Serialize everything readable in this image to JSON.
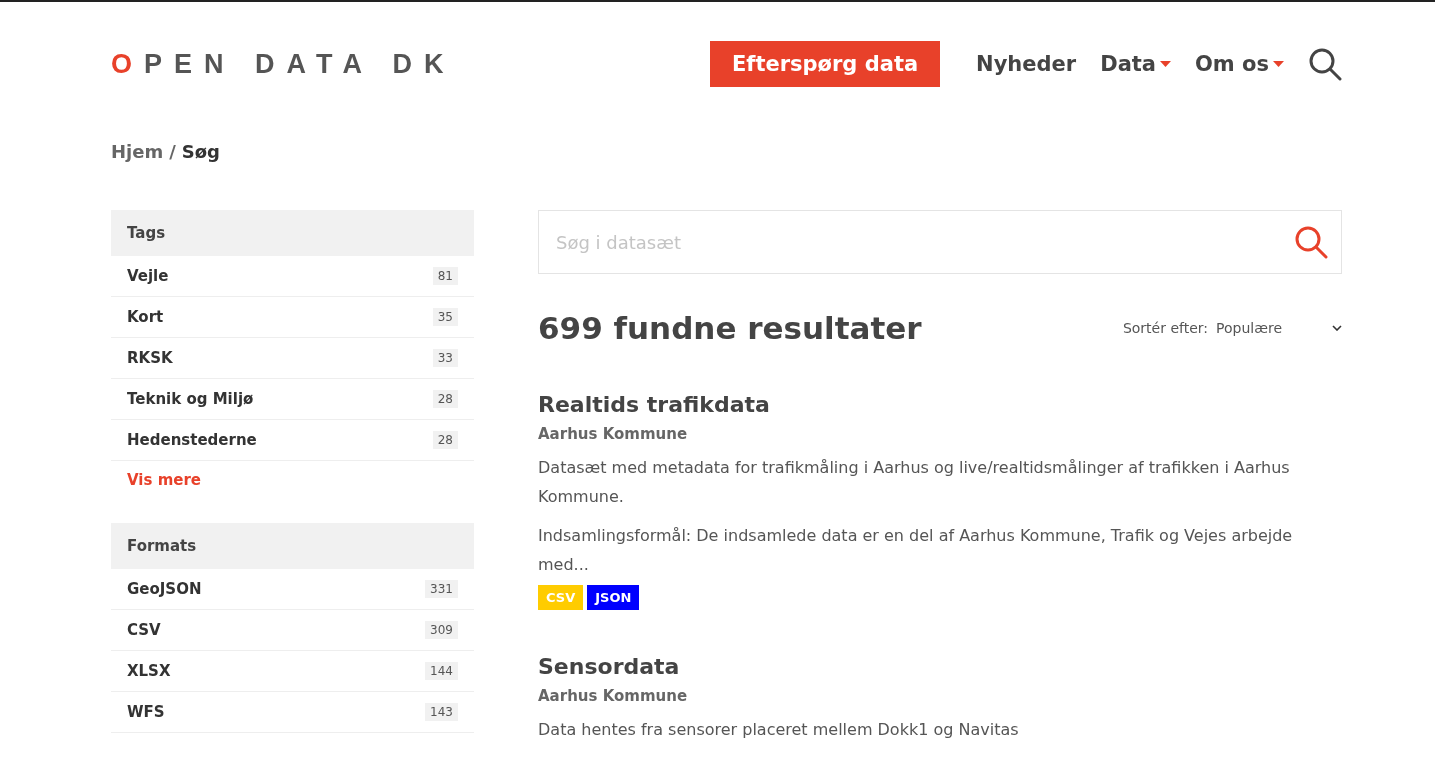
{
  "logo": {
    "text": "OPEN DATA DK"
  },
  "nav": {
    "cta": "Efterspørg data",
    "items": [
      {
        "label": "Nyheder",
        "dropdown": false
      },
      {
        "label": "Data",
        "dropdown": true
      },
      {
        "label": "Om os",
        "dropdown": true
      }
    ]
  },
  "breadcrumb": {
    "items": [
      "Hjem",
      "Søg"
    ],
    "separator": "/"
  },
  "facets": [
    {
      "title": "Tags",
      "items": [
        {
          "label": "Vejle",
          "count": "81"
        },
        {
          "label": "Kort",
          "count": "35"
        },
        {
          "label": "RKSK",
          "count": "33"
        },
        {
          "label": "Teknik og Miljø",
          "count": "28"
        },
        {
          "label": "Hedenstederne",
          "count": "28"
        }
      ],
      "more": "Vis mere"
    },
    {
      "title": "Formats",
      "items": [
        {
          "label": "GeoJSON",
          "count": "331"
        },
        {
          "label": "CSV",
          "count": "309"
        },
        {
          "label": "XLSX",
          "count": "144"
        },
        {
          "label": "WFS",
          "count": "143"
        }
      ]
    }
  ],
  "search": {
    "placeholder": "Søg i datasæt"
  },
  "results_heading": "699 fundne resultater",
  "sort": {
    "label": "Sortér efter:",
    "value": "Populære"
  },
  "results": [
    {
      "title": "Realtids trafikdata",
      "publisher": "Aarhus Kommune",
      "paragraphs": [
        "Datasæt med metadata for trafikmåling i Aarhus og live/realtidsmålinger af trafikken i Aarhus Kommune.",
        "Indsamlingsformål: De indsamlede data er en del af Aarhus Kommune, Trafik og Vejes arbejde med..."
      ],
      "formats": [
        {
          "label": "CSV",
          "color": "#ffcc00"
        },
        {
          "label": "JSON",
          "color": "#0000ff"
        }
      ]
    },
    {
      "title": "Sensordata",
      "publisher": "Aarhus Kommune",
      "paragraphs": [
        "Data hentes fra sensorer placeret mellem Dokk1 og Navitas"
      ]
    }
  ]
}
